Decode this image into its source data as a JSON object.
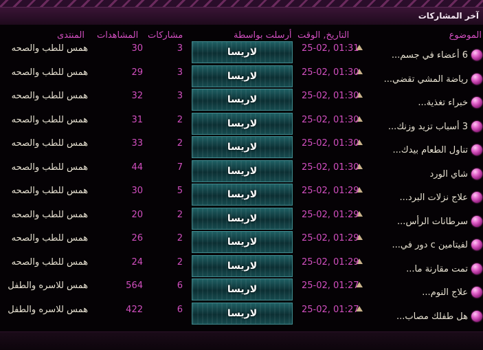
{
  "board": {
    "title": "آخر المشاركات",
    "headers": {
      "topic": "الموضوع",
      "date": "التاريخ, الوقت",
      "poster": "أرسلت بواسطة",
      "replies": "مشاركات",
      "views": "المشاهدات",
      "forum": "المنتدى"
    },
    "rows": [
      {
        "topic": "6 أعضاء في جسم...",
        "date": "25-02, 01:31",
        "poster": "لاريسا",
        "replies": "3",
        "views": "30",
        "forum": "همس للطب والصحه"
      },
      {
        "topic": "رياضة المشي تقضي...",
        "date": "25-02, 01:30",
        "poster": "لاريسا",
        "replies": "3",
        "views": "29",
        "forum": "همس للطب والصحه"
      },
      {
        "topic": "خبراء تغذية...",
        "date": "25-02, 01:30",
        "poster": "لاريسا",
        "replies": "3",
        "views": "32",
        "forum": "همس للطب والصحه"
      },
      {
        "topic": "3 أسباب تزيد وزنك...",
        "date": "25-02, 01:30",
        "poster": "لاريسا",
        "replies": "2",
        "views": "31",
        "forum": "همس للطب والصحه"
      },
      {
        "topic": "تناول الطعام بيدك...",
        "date": "25-02, 01:30",
        "poster": "لاريسا",
        "replies": "2",
        "views": "33",
        "forum": "همس للطب والصحه"
      },
      {
        "topic": "شاي الورد",
        "date": "25-02, 01:30",
        "poster": "لاريسا",
        "replies": "7",
        "views": "44",
        "forum": "همس للطب والصحه"
      },
      {
        "topic": "علاج نزلات البرد...",
        "date": "25-02, 01:29",
        "poster": "لاريسا",
        "replies": "5",
        "views": "30",
        "forum": "همس للطب والصحه"
      },
      {
        "topic": "سرطانات الرأس...",
        "date": "25-02, 01:29",
        "poster": "لاريسا",
        "replies": "2",
        "views": "20",
        "forum": "همس للطب والصحه"
      },
      {
        "topic": "لفيتامين c دور في...",
        "date": "25-02, 01:29",
        "poster": "لاريسا",
        "replies": "2",
        "views": "26",
        "forum": "همس للطب والصحه"
      },
      {
        "topic": "تمت مقارنة ما...",
        "date": "25-02, 01:29",
        "poster": "لاريسا",
        "replies": "2",
        "views": "24",
        "forum": "همس للطب والصحه"
      },
      {
        "topic": "علاج النوم...",
        "date": "25-02, 01:27",
        "poster": "لاريسا",
        "replies": "6",
        "views": "564",
        "forum": "همس للاسره والطفل"
      },
      {
        "topic": "هل طفلك مصاب...",
        "date": "25-02, 01:27",
        "poster": "لاريسا",
        "replies": "6",
        "views": "422",
        "forum": "همس للاسره والطفل"
      }
    ]
  },
  "colors": {
    "accent": "#d24fc0",
    "text": "#e8e2d2",
    "background": "#000000"
  },
  "icons": {
    "row_bullet": "pink-orb-icon",
    "last_post": "triangle-up-icon"
  }
}
